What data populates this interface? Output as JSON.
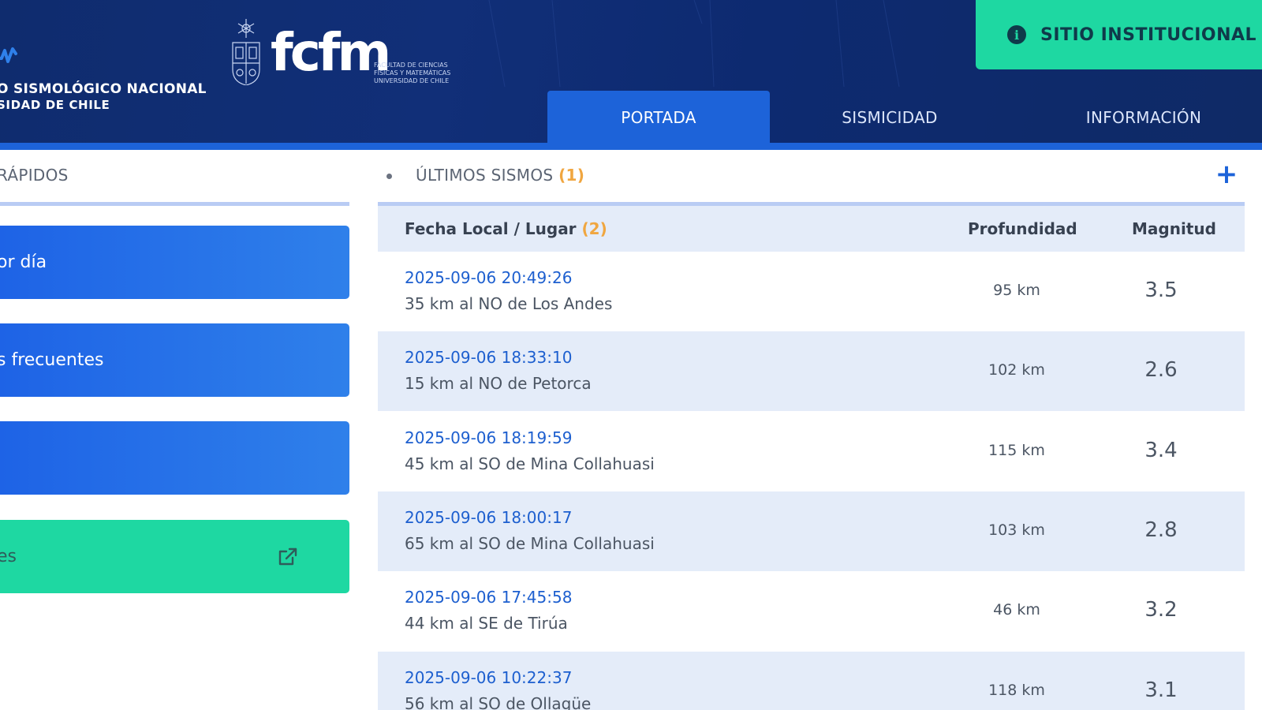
{
  "header": {
    "org_line1": "O SISMOLÓGICO NACIONAL",
    "org_line2": "SIDAD DE CHILE",
    "fcfm_word": "fcfm",
    "fcfm_sub": "FACULTAD DE CIENCIAS FÍSICAS Y MATEMÁTICAS UNIVERSIDAD DE CHILE",
    "institutional_button": "SITIO INSTITUCIONAL",
    "tabs": [
      {
        "label": "PORTADA",
        "active": true
      },
      {
        "label": "SISMICIDAD",
        "active": false
      },
      {
        "label": "INFORMACIÓN",
        "active": false
      }
    ],
    "colors": {
      "header_bg": "#112f78",
      "accent": "#1d63d9",
      "green": "#1ed8a2"
    }
  },
  "left": {
    "title": "RÁPIDOS",
    "buttons": [
      {
        "label": "or día",
        "icon": ""
      },
      {
        "label": "s frecuentes",
        "icon": ""
      },
      {
        "label": "",
        "icon": ""
      },
      {
        "label": "es",
        "icon": "external-link-icon"
      }
    ]
  },
  "quakes": {
    "title": "ÚLTIMOS SISMOS",
    "title_note": "(1)",
    "more": "+",
    "col_fecha": "Fecha Local / Lugar",
    "col_fecha_note": "(2)",
    "col_prof": "Profundidad",
    "col_mag": "Magnitud",
    "rows": [
      {
        "date": "2025-09-06 20:49:26",
        "place": "35 km al NO de Los Andes",
        "depth": "95 km",
        "mag": "3.5"
      },
      {
        "date": "2025-09-06 18:33:10",
        "place": "15 km al NO de Petorca",
        "depth": "102 km",
        "mag": "2.6"
      },
      {
        "date": "2025-09-06 18:19:59",
        "place": "45 km al SO de Mina Collahuasi",
        "depth": "115 km",
        "mag": "3.4"
      },
      {
        "date": "2025-09-06 18:00:17",
        "place": "65 km al SO de Mina Collahuasi",
        "depth": "103 km",
        "mag": "2.8"
      },
      {
        "date": "2025-09-06 17:45:58",
        "place": "44 km al SE de Tirúa",
        "depth": "46 km",
        "mag": "3.2"
      },
      {
        "date": "2025-09-06 10:22:37",
        "place": "56 km al SO de Ollagüe",
        "depth": "118 km",
        "mag": "3.1"
      }
    ]
  }
}
